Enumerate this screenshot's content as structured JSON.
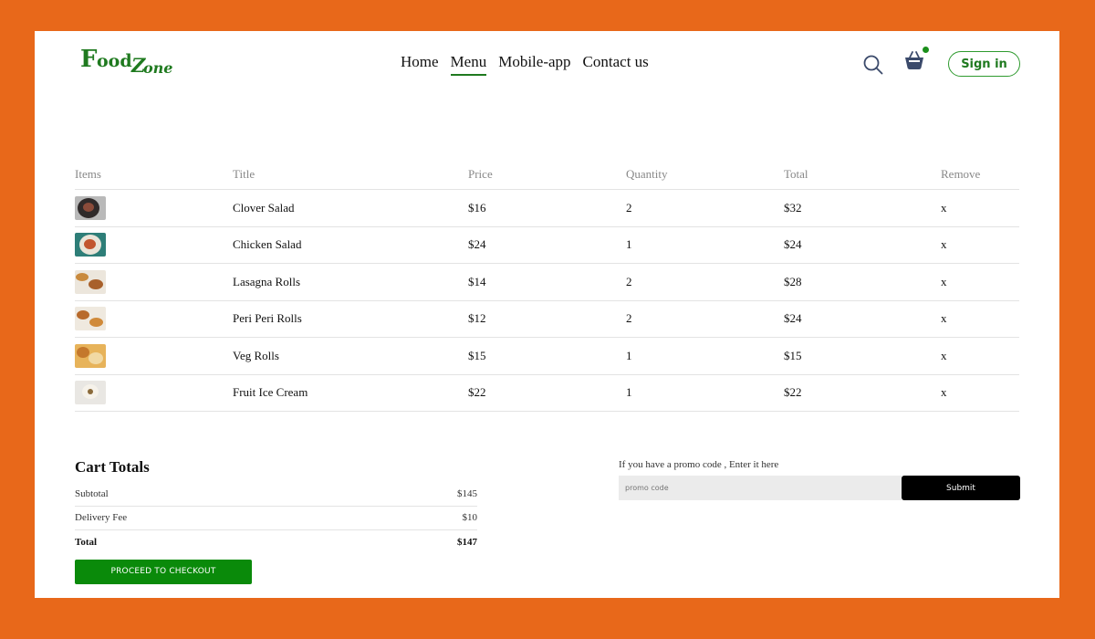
{
  "brand": {
    "logo_f": "F",
    "logo_ood": "ood",
    "logo_z": "Z",
    "logo_one": "one",
    "color": "#1f7a1f"
  },
  "nav": {
    "items": [
      {
        "label": "Home",
        "active": false
      },
      {
        "label": "Menu",
        "active": true
      },
      {
        "label": "Mobile-app",
        "active": false
      },
      {
        "label": "Contact us",
        "active": false
      }
    ]
  },
  "header": {
    "signin_label": "Sign in",
    "search_icon": "search-icon",
    "basket_icon": "basket-icon"
  },
  "cart": {
    "columns": [
      "Items",
      "Title",
      "Price",
      "Quantity",
      "Total",
      "Remove"
    ],
    "rows": [
      {
        "title": "Clover Salad",
        "price": "$16",
        "qty": "2",
        "total": "$32",
        "remove": "x"
      },
      {
        "title": "Chicken Salad",
        "price": "$24",
        "qty": "1",
        "total": "$24",
        "remove": "x"
      },
      {
        "title": "Lasagna Rolls",
        "price": "$14",
        "qty": "2",
        "total": "$28",
        "remove": "x"
      },
      {
        "title": "Peri Peri Rolls",
        "price": "$12",
        "qty": "2",
        "total": "$24",
        "remove": "x"
      },
      {
        "title": "Veg Rolls",
        "price": "$15",
        "qty": "1",
        "total": "$15",
        "remove": "x"
      },
      {
        "title": "Fruit Ice Cream",
        "price": "$22",
        "qty": "1",
        "total": "$22",
        "remove": "x"
      }
    ]
  },
  "totals": {
    "heading": "Cart Totals",
    "subtotal_label": "Subtotal",
    "subtotal_value": "$145",
    "delivery_label": "Delivery Fee",
    "delivery_value": "$10",
    "total_label": "Total",
    "total_value": "$147",
    "checkout_label": "PROCEED TO CHECKOUT"
  },
  "promo": {
    "label": "If you have a promo code , Enter it here",
    "placeholder": "promo code",
    "submit_label": "Submit"
  },
  "colors": {
    "frame": "#E8681A",
    "accent": "#0a8a0a",
    "submit": "#000000"
  }
}
